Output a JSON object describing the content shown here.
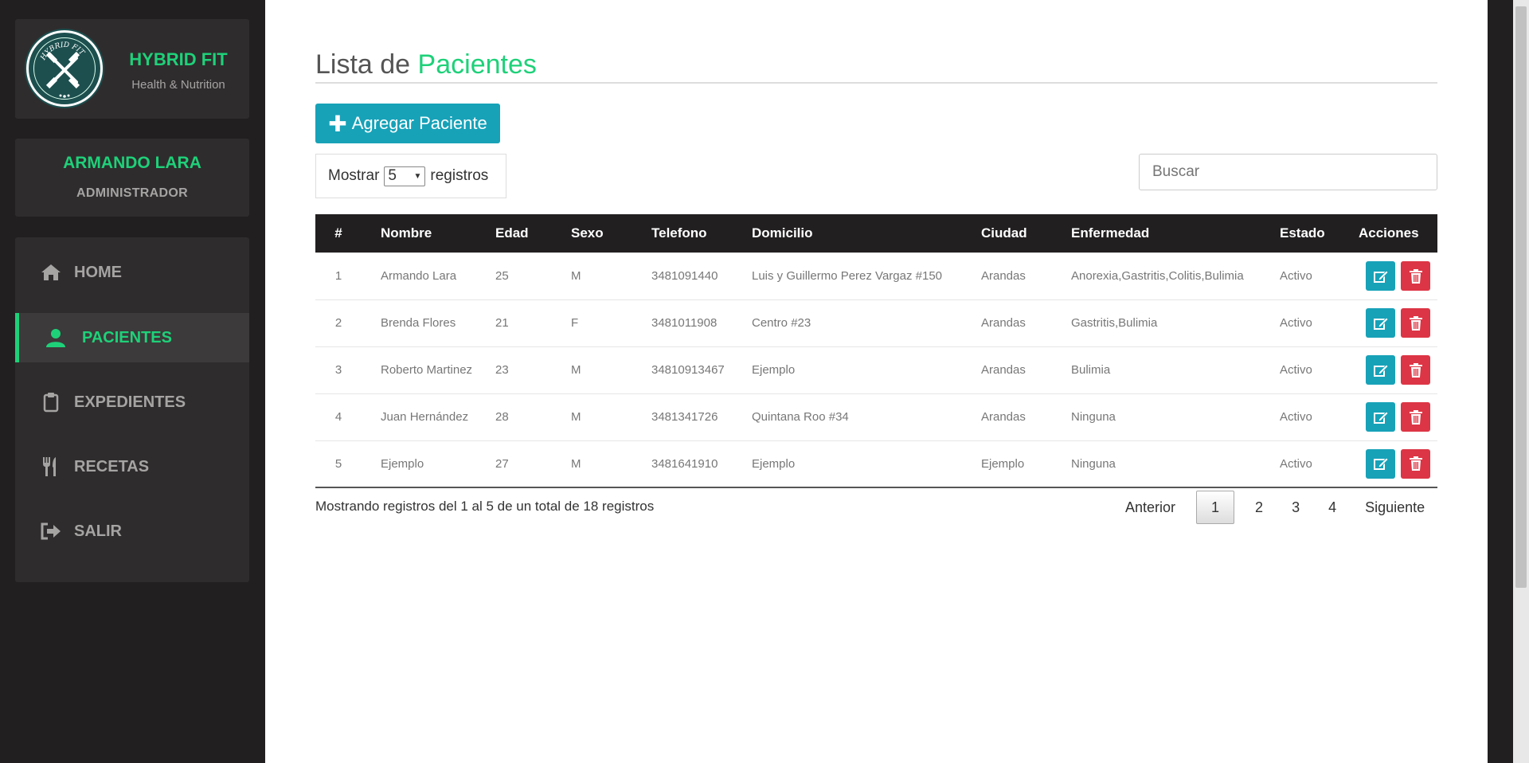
{
  "brand": {
    "name": "HYBRID FIT",
    "subtitle": "Health & Nutrition",
    "logo_text": "HYBRID FIT"
  },
  "user": {
    "name": "ARMANDO LARA",
    "role": "ADMINISTRADOR"
  },
  "nav": [
    {
      "label": "HOME",
      "icon": "home-icon"
    },
    {
      "label": "PACIENTES",
      "icon": "user-icon",
      "active": true
    },
    {
      "label": "EXPEDIENTES",
      "icon": "clipboard-icon"
    },
    {
      "label": "RECETAS",
      "icon": "utensils-icon"
    },
    {
      "label": "SALIR",
      "icon": "sign-out-icon"
    }
  ],
  "page": {
    "title_prefix": "Lista de",
    "title_accent": "Pacientes",
    "add_button": "Agregar Paciente",
    "length_prefix": "Mostrar",
    "length_value": "5",
    "length_suffix": "registros",
    "search_placeholder": "Buscar"
  },
  "table": {
    "headers": [
      "#",
      "Nombre",
      "Edad",
      "Sexo",
      "Telefono",
      "Domicilio",
      "Ciudad",
      "Enfermedad",
      "Estado",
      "Acciones"
    ],
    "rows": [
      [
        "1",
        "Armando Lara",
        "25",
        "M",
        "3481091440",
        "Luis y Guillermo Perez Vargaz #150",
        "Arandas",
        "Anorexia,Gastritis,Colitis,Bulimia",
        "Activo"
      ],
      [
        "2",
        "Brenda Flores",
        "21",
        "F",
        "3481011908",
        "Centro #23",
        "Arandas",
        "Gastritis,Bulimia",
        "Activo"
      ],
      [
        "3",
        "Roberto Martinez",
        "23",
        "M",
        "34810913467",
        "Ejemplo",
        "Arandas",
        "Bulimia",
        "Activo"
      ],
      [
        "4",
        "Juan Hernández",
        "28",
        "M",
        "3481341726",
        "Quintana Roo #34",
        "Arandas",
        "Ninguna",
        "Activo"
      ],
      [
        "5",
        "Ejemplo",
        "27",
        "M",
        "3481641910",
        "Ejemplo",
        "Ejemplo",
        "Ninguna",
        "Activo"
      ]
    ]
  },
  "footer": {
    "info": "Mostrando registros del 1 al 5 de un total de 18 registros",
    "prev": "Anterior",
    "pages": [
      "1",
      "2",
      "3",
      "4"
    ],
    "current_page": "1",
    "next": "Siguiente"
  },
  "colors": {
    "accent": "#1ed179",
    "sidebar": "#221f20",
    "panel": "#2f2c2d",
    "edit": "#17a2b8",
    "delete": "#dc3545"
  }
}
